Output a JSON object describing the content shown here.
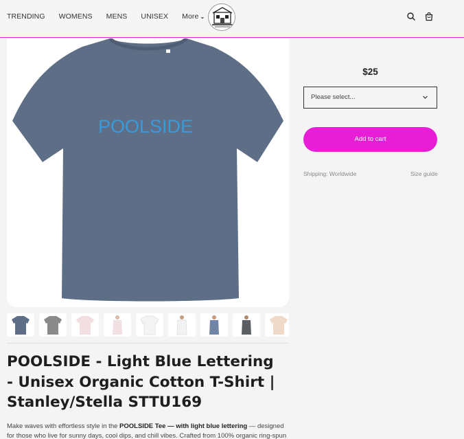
{
  "nav": {
    "items": [
      {
        "label": "TRENDING"
      },
      {
        "label": "WOMENS"
      },
      {
        "label": "MENS"
      },
      {
        "label": "UNISEX"
      },
      {
        "label": "More"
      }
    ]
  },
  "product": {
    "image_text": "POOLSIDE",
    "image_text_color": "#3a9ad9",
    "shirt_color": "#5d6e86",
    "title": "POOLSIDE - Light Blue Lettering - Unisex Organic Cotton T-Shirt | Stanley/Stella STTU169",
    "description": {
      "part1": "Make waves with effortless style in the ",
      "bold": "POOLSIDE Tee — with light blue lettering",
      "part2": " — designed for those who live for sunny days, cool dips, and chill vibes. Crafted from 100% organic ring-spun"
    },
    "price": "$25",
    "select_placeholder": "Please select...",
    "add_to_cart": "Add to cart",
    "shipping": "Shipping: Worldwide",
    "size_guide": "Size guide"
  },
  "thumbnails": [
    {
      "color": "#5d6e86",
      "kind": "tee"
    },
    {
      "color": "#8a8a8a",
      "kind": "tee"
    },
    {
      "color": "#f3dfe1",
      "kind": "tee"
    },
    {
      "color": "#f1e0e2",
      "kind": "model"
    },
    {
      "color": "#f4f4f4",
      "kind": "tee"
    },
    {
      "color": "#f2f2f2",
      "kind": "model"
    },
    {
      "color": "#6f84a6",
      "kind": "model"
    },
    {
      "color": "#5b5f63",
      "kind": "model"
    },
    {
      "color": "#efd9c8",
      "kind": "tee"
    }
  ],
  "colors": {
    "accent": "#e81ed6",
    "header_border": "#e02ad6"
  }
}
